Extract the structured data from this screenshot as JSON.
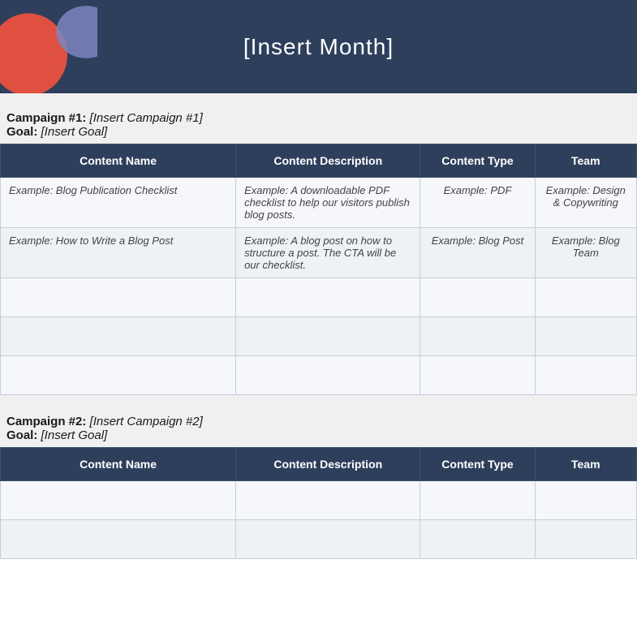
{
  "header": {
    "title": "[Insert Month]"
  },
  "blobs": {
    "orange_color": "#e05040",
    "blue_color": "#6b7ab5"
  },
  "campaigns": [
    {
      "id": "campaign-1",
      "number": "Campaign #1:",
      "name": "[Insert Campaign #1]",
      "goal_label": "Goal:",
      "goal": "[Insert Goal]",
      "columns": [
        "Content Name",
        "Content Description",
        "Content Type",
        "Team"
      ],
      "rows": [
        {
          "name": "Example: Blog Publication Checklist",
          "description": "Example: A downloadable PDF checklist to help our visitors publish blog posts.",
          "type": "Example: PDF",
          "team": "Example: Design & Copywriting"
        },
        {
          "name": "Example: How to Write a Blog Post",
          "description": "Example: A blog post on how to structure a post. The CTA will be our checklist.",
          "type": "Example: Blog Post",
          "team": "Example: Blog Team"
        },
        {
          "name": "",
          "description": "",
          "type": "",
          "team": ""
        },
        {
          "name": "",
          "description": "",
          "type": "",
          "team": ""
        },
        {
          "name": "",
          "description": "",
          "type": "",
          "team": ""
        }
      ]
    },
    {
      "id": "campaign-2",
      "number": "Campaign #2:",
      "name": "[Insert Campaign #2]",
      "goal_label": "Goal:",
      "goal": "[Insert Goal]",
      "columns": [
        "Content Name",
        "Content Description",
        "Content Type",
        "Team"
      ],
      "rows": [
        {
          "name": "",
          "description": "",
          "type": "",
          "team": ""
        },
        {
          "name": "",
          "description": "",
          "type": "",
          "team": ""
        }
      ]
    }
  ]
}
